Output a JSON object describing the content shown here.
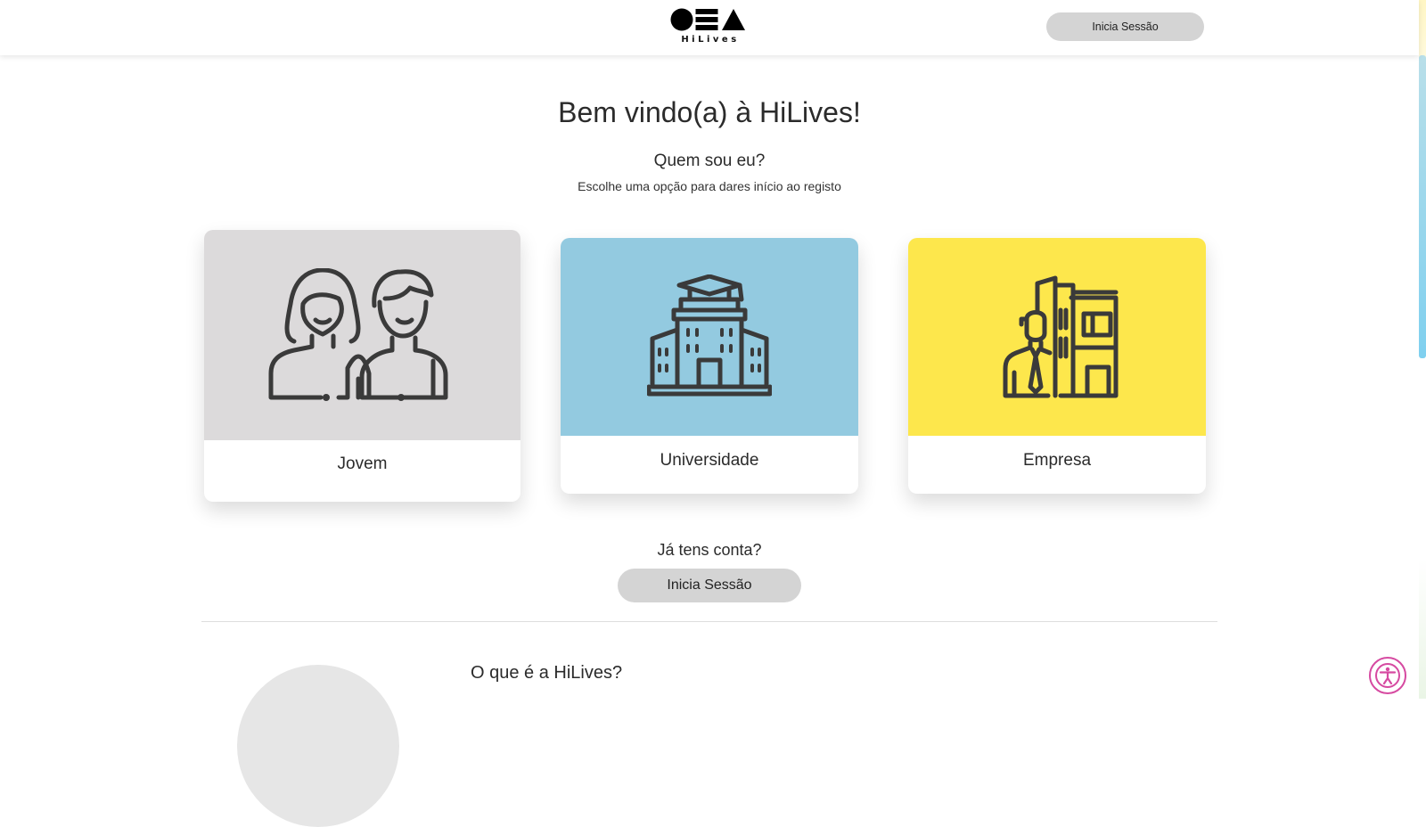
{
  "header": {
    "logo_text": "HiLives",
    "login_label": "Inicia Sessão"
  },
  "main": {
    "title": "Bem vindo(a) à HiLives!",
    "subtitle": "Quem sou eu?",
    "hint": "Escolhe uma opção para dares início ao registo"
  },
  "options": [
    {
      "label": "Jovem",
      "color": "#dcdadb",
      "icon": "young-people-icon"
    },
    {
      "label": "Universidade",
      "color": "#93cae0",
      "icon": "university-building-icon"
    },
    {
      "label": "Empresa",
      "color": "#fde74c",
      "icon": "business-person-icon"
    }
  ],
  "account": {
    "question": "Já tens conta?",
    "login_label": "Inicia Sessão"
  },
  "about": {
    "title": "O que é a HiLives?"
  },
  "accessibility": {
    "icon": "accessibility-icon",
    "color": "#d64aa1"
  }
}
